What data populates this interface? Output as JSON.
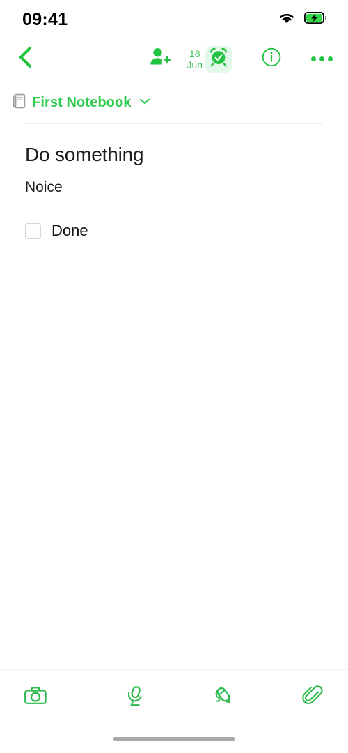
{
  "status_bar": {
    "time": "09:41",
    "wifi_icon": "wifi-icon",
    "battery_icon": "battery-charging-icon",
    "battery_charging": true
  },
  "toolbar": {
    "back_icon": "chevron-left-icon",
    "add_person_icon": "person-add-icon",
    "reminder_day": "18",
    "reminder_month": "Jun",
    "alarm_icon": "alarm-check-icon",
    "alarm_active": true,
    "info_icon": "info-circle-icon",
    "more_icon": "more-horizontal-icon"
  },
  "notebook": {
    "icon": "notebook-icon",
    "name": "First Notebook",
    "chevron_icon": "chevron-down-icon"
  },
  "note": {
    "title": "Do something",
    "body": "Noice",
    "todos": [
      {
        "label": "Done",
        "checked": false
      }
    ]
  },
  "bottom_bar": {
    "items": [
      {
        "icon": "camera-icon",
        "name": "camera"
      },
      {
        "icon": "microphone-icon",
        "name": "audio"
      },
      {
        "icon": "handwriting-pen-icon",
        "name": "handwriting"
      },
      {
        "icon": "paperclip-icon",
        "name": "attachment"
      }
    ]
  },
  "home_indicator": "home-indicator",
  "colors": {
    "accent_green": "#2ecc4e",
    "toolbar_green": "#22c340",
    "alarm_badge_bg": "#e4f8e9",
    "text_dark": "#1c1c1e",
    "divider": "#eeeef1",
    "checkbox_border": "#d4d4d8",
    "home_indicator": "#a8a8ad"
  }
}
